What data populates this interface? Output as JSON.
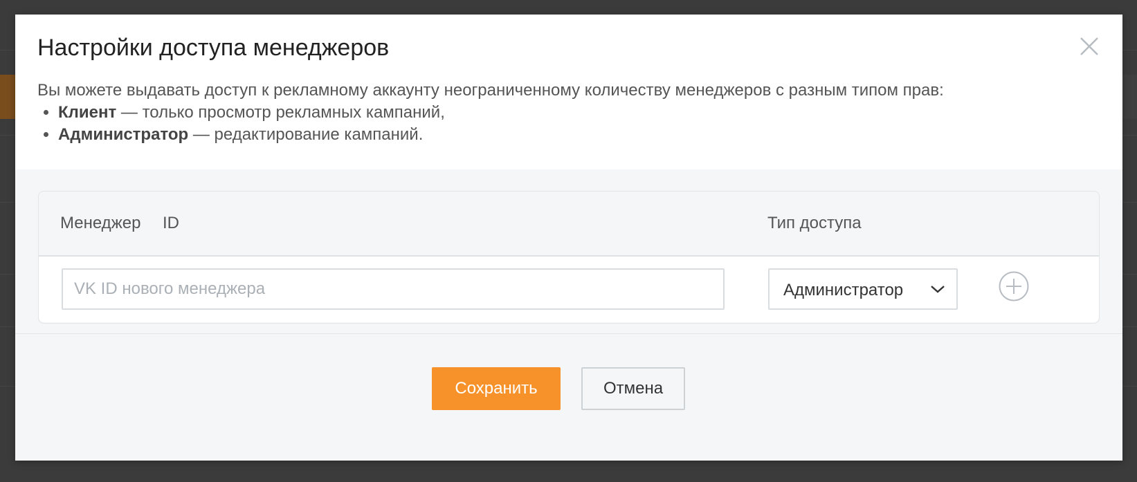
{
  "modal": {
    "title": "Настройки доступа менеджеров",
    "description": "Вы можете выдавать доступ к рекламному аккаунту неограниченному количеству менеджеров с разным типом прав:",
    "roles": [
      {
        "name": "Клиент",
        "text": " — только просмотр рекламных кампаний,"
      },
      {
        "name": "Администратор",
        "text": " — редактирование кампаний."
      }
    ],
    "table": {
      "col_manager": "Менеджер",
      "col_id": "ID",
      "col_access": "Тип доступа",
      "input_placeholder": "VK ID нового менеджера",
      "input_value": "",
      "access_selected": "Администратор"
    },
    "save_label": "Сохранить",
    "cancel_label": "Отмена"
  },
  "icons": {
    "close": "close-icon",
    "chevron": "chevron-down-icon",
    "add": "add-circle-icon"
  },
  "colors": {
    "accent": "#f7922a",
    "overlay": "#3b3b3b"
  }
}
